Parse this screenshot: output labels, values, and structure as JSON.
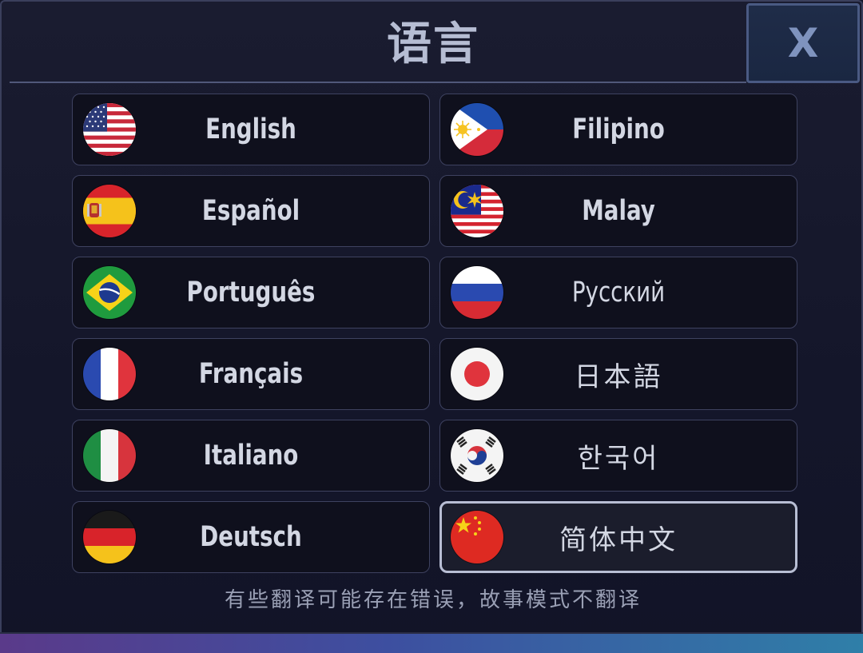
{
  "dialog": {
    "title": "语言",
    "close_label": "X",
    "note": "有些翻译可能存在错误，故事模式不翻译"
  },
  "languages": [
    {
      "label": "English",
      "flag": "us-flag-icon"
    },
    {
      "label": "Filipino",
      "flag": "philippines-flag-icon"
    },
    {
      "label": "Español",
      "flag": "spain-flag-icon"
    },
    {
      "label": "Malay",
      "flag": "malaysia-flag-icon"
    },
    {
      "label": "Português",
      "flag": "brazil-flag-icon"
    },
    {
      "label": "Русский",
      "flag": "russia-flag-icon"
    },
    {
      "label": "Français",
      "flag": "france-flag-icon"
    },
    {
      "label": "日本語",
      "flag": "japan-flag-icon"
    },
    {
      "label": "Italiano",
      "flag": "italy-flag-icon"
    },
    {
      "label": "한국어",
      "flag": "korea-flag-icon"
    },
    {
      "label": "Deutsch",
      "flag": "germany-flag-icon"
    },
    {
      "label": "简体中文",
      "flag": "china-flag-icon",
      "selected": true
    }
  ],
  "colors": {
    "selected_border": "#b8bed4",
    "button_bg": "#0f101d",
    "accent_bar": "#3d4fa0"
  }
}
